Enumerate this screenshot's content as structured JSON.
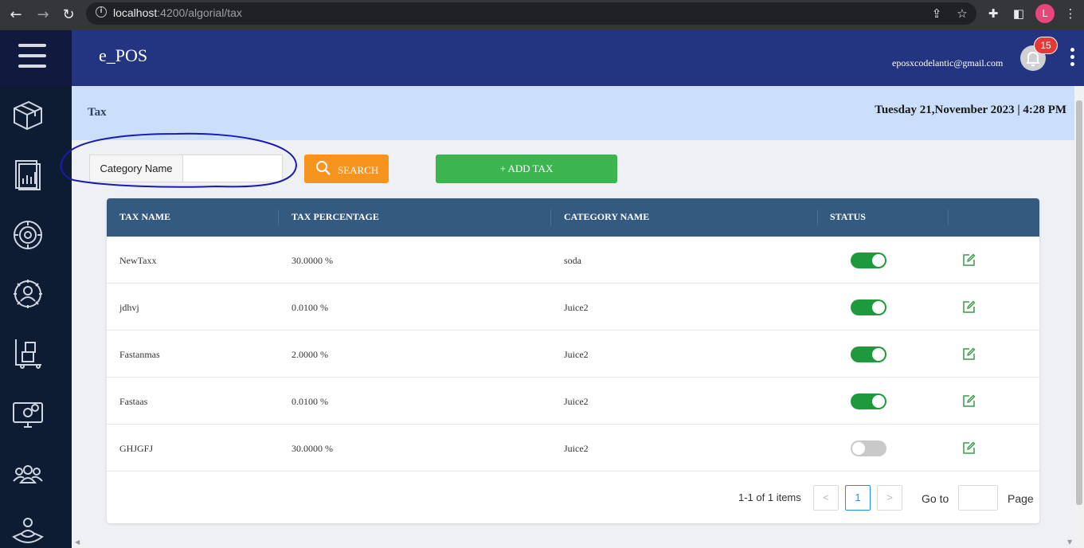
{
  "browser": {
    "url_host": "localhost",
    "url_path": ":4200/algorial/tax",
    "profile_initial": "L"
  },
  "header": {
    "brand": "e_POS",
    "email": "eposxcodelantic@gmail.com",
    "notification_count": "15"
  },
  "page": {
    "title": "Tax",
    "datetime": "Tuesday 21,November 2023 | 4:28 PM"
  },
  "filter": {
    "label": "Category Name",
    "value": ""
  },
  "actions": {
    "search_label": "SEARCH",
    "add_label": "+ ADD TAX"
  },
  "table": {
    "columns": [
      "TAX NAME",
      "TAX PERCENTAGE",
      "CATEGORY NAME",
      "STATUS"
    ],
    "rows": [
      {
        "name": "NewTaxx",
        "percentage": "30.0000 %",
        "category": "soda",
        "status": true
      },
      {
        "name": "jdhvj",
        "percentage": "0.0100 %",
        "category": "Juice2",
        "status": true
      },
      {
        "name": "Fastanmas",
        "percentage": "2.0000 %",
        "category": "Juice2",
        "status": true
      },
      {
        "name": "Fastaas",
        "percentage": "0.0100 %",
        "category": "Juice2",
        "status": true
      },
      {
        "name": "GHJGFJ",
        "percentage": "30.0000 %",
        "category": "Juice2",
        "status": false
      }
    ]
  },
  "pagination": {
    "summary": "1-1 of 1 items",
    "prev": "<",
    "current_page": "1",
    "next": ">",
    "goto_label": "Go to",
    "page_label": "Page"
  },
  "sidebar": {
    "icons": [
      "box-icon",
      "report-icon",
      "gear-cycle-icon",
      "user-settings-icon",
      "inventory-icon",
      "monitor-settings-icon",
      "users-group-icon",
      "hand-user-icon"
    ]
  },
  "colors": {
    "header": "#233580",
    "sidebar": "#0e1c33",
    "table_header": "#355a80",
    "search": "#f7941d",
    "add": "#3cb551",
    "toggle_on": "#1e9a3c"
  }
}
